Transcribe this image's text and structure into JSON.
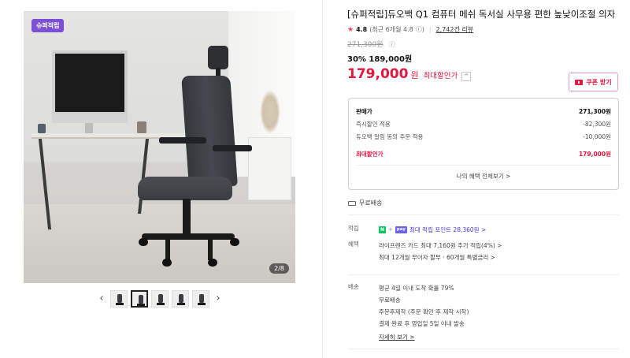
{
  "gallery": {
    "badge": "슈퍼적립",
    "counter": "2/8",
    "prev_icon": "chevron-left-icon",
    "next_icon": "chevron-right-icon",
    "prev_glyph": "‹",
    "next_glyph": "›",
    "thumbnail_count": 5,
    "active_thumbnail": 2
  },
  "product": {
    "title": "[슈퍼적립]듀오백 Q1 컴퓨터 메쉬 독서실 사무용 편한 높낮이조절 의자",
    "rating_star": "★",
    "rating": "4.8",
    "rating_recent": "(최근 6개월 4.8",
    "rating_recent_icon": "ⓘ)",
    "reviews": "2,742건 리뷰",
    "original_price": "271,300원",
    "original_price_icon": "ⓘ",
    "discount_line": "30% 189,000원",
    "max_price": "179,000",
    "max_price_unit": "원",
    "max_price_label": "최대할인가",
    "caret": "^",
    "coupon_button": "쿠폰 받기"
  },
  "price_box": {
    "rows": [
      {
        "label": "판매가",
        "value": "271,300원"
      },
      {
        "label": "즉시할인 적용",
        "value": "-82,300원"
      },
      {
        "label": "듀오백 알림 동의 주문 적용",
        "value": "-10,000원"
      }
    ],
    "total_label": "최대할인가",
    "total_value": "179,000원",
    "more": "나의 혜택 전체보기 >"
  },
  "shipping_tag": "무료배송",
  "details": {
    "points_label": "적립",
    "points_badge_n": "N",
    "points_badge_plus": "+",
    "points_badge_pay": "pay",
    "points_text": "최대 적립 포인트 28,360원 >",
    "benefit_label": "혜택",
    "benefit_lines": [
      "라이프렌즈 카드 최대 7,160원 추가 적립(4%) >",
      "최대 12개월 무이자 할부 · 60개월 특별금리 >"
    ],
    "delivery_label": "배송",
    "delivery_lines": [
      "평균 4일 이내 도착 확률 79%",
      "무료배송",
      "주문후제작 (주문 확인 후 제작 시작)",
      "결제 완료 후 영업일 5일 이내 발송"
    ],
    "delivery_more": "자세히 보기 >"
  },
  "colors": {
    "accent_red": "#e2163f",
    "badge_purple": "#7b4fd6",
    "naver_green": "#03c75a",
    "pay_purple": "#6b63e8"
  }
}
